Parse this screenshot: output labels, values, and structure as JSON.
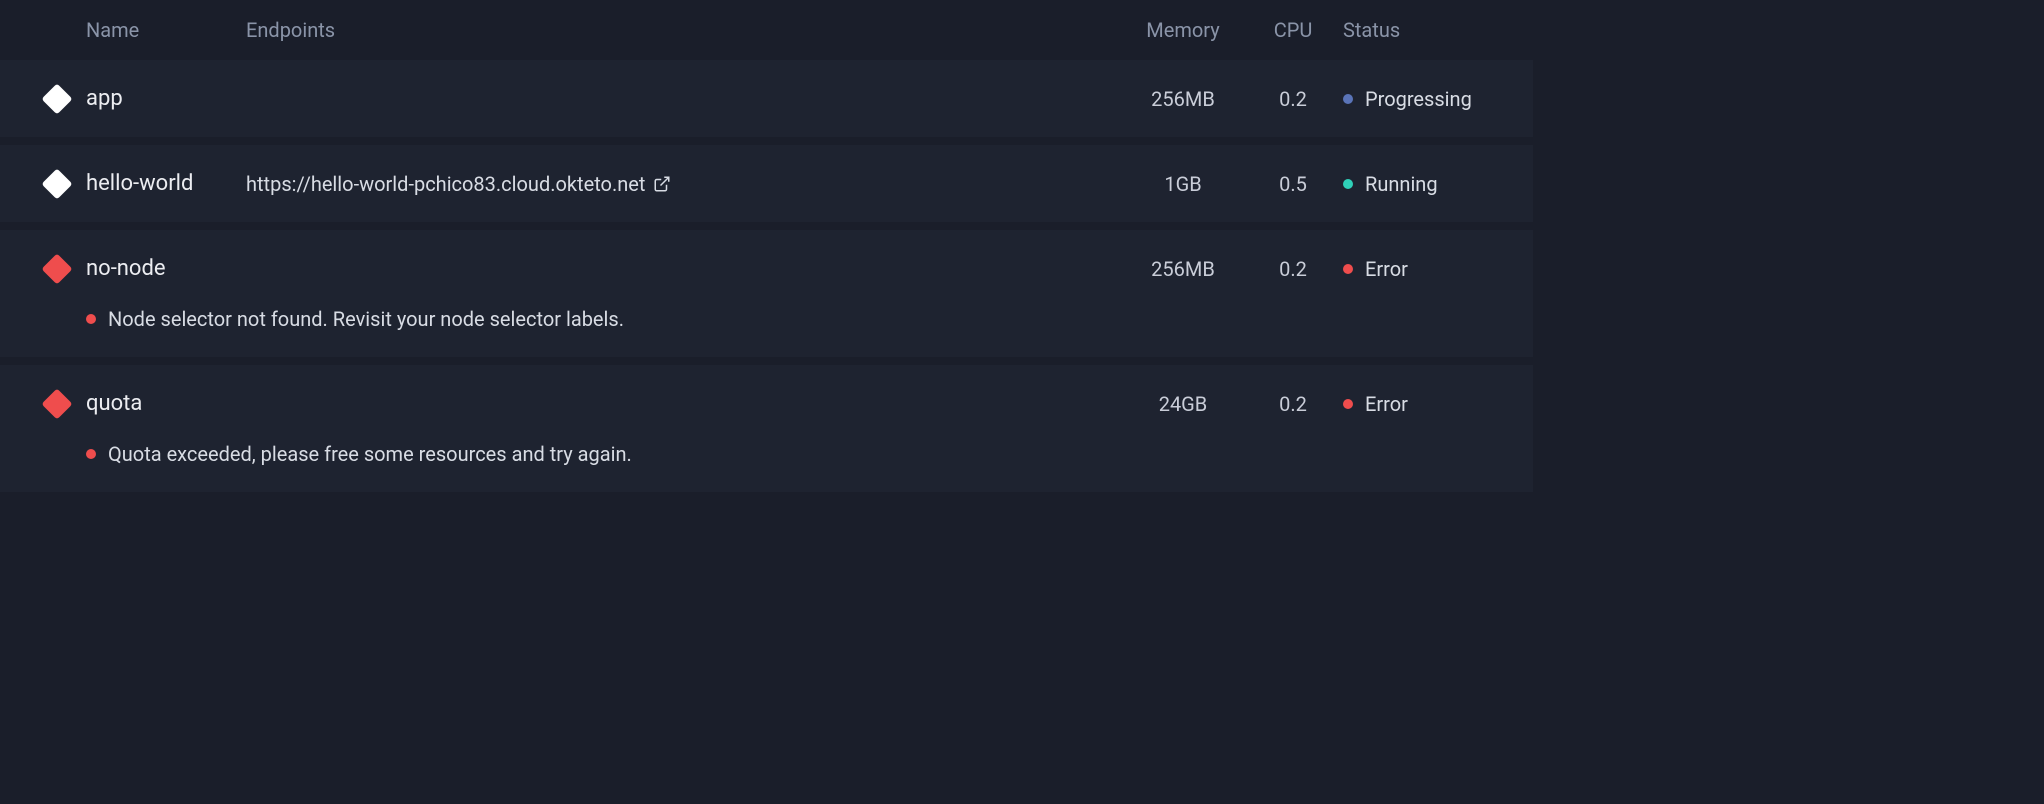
{
  "headers": {
    "name": "Name",
    "endpoints": "Endpoints",
    "memory": "Memory",
    "cpu": "CPU",
    "status": "Status"
  },
  "rows": [
    {
      "name": "app",
      "endpoint": "",
      "memory": "256MB",
      "cpu": "0.2",
      "status": "Progressing",
      "status_kind": "progressing",
      "diamond": "white",
      "error_detail": ""
    },
    {
      "name": "hello-world",
      "endpoint": "https://hello-world-pchico83.cloud.okteto.net",
      "memory": "1GB",
      "cpu": "0.5",
      "status": "Running",
      "status_kind": "running",
      "diamond": "white",
      "error_detail": ""
    },
    {
      "name": "no-node",
      "endpoint": "",
      "memory": "256MB",
      "cpu": "0.2",
      "status": "Error",
      "status_kind": "error",
      "diamond": "red",
      "error_detail": "Node selector not found. Revisit your node selector labels."
    },
    {
      "name": "quota",
      "endpoint": "",
      "memory": "24GB",
      "cpu": "0.2",
      "status": "Error",
      "status_kind": "error",
      "diamond": "red",
      "error_detail": "Quota exceeded, please free some resources and try again."
    }
  ]
}
